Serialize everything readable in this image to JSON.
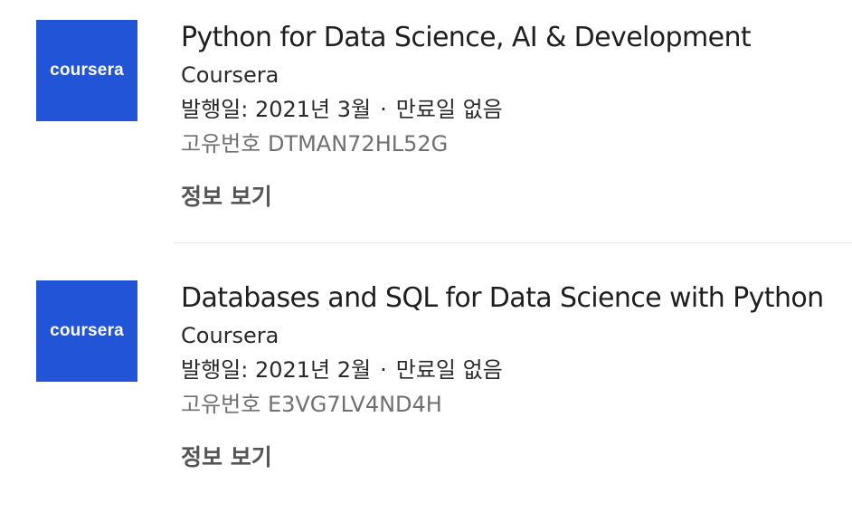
{
  "certifications": [
    {
      "logo_text": "coursera",
      "title": "Python for Data Science, AI & Development",
      "issuer": "Coursera",
      "issued": "발행일: 2021년 3월",
      "separator": "·",
      "expiry": "만료일 없음",
      "credential_id": "고유번호 DTMAN72HL52G",
      "show_label": "정보 보기"
    },
    {
      "logo_text": "coursera",
      "title": "Databases and SQL for Data Science with Python",
      "issuer": "Coursera",
      "issued": "발행일: 2021년 2월",
      "separator": "·",
      "expiry": "만료일 없음",
      "credential_id": "고유번호 E3VG7LV4ND4H",
      "show_label": "정보 보기"
    }
  ],
  "colors": {
    "logo_background": "#2154d6",
    "divider": "#e4e4e4"
  }
}
